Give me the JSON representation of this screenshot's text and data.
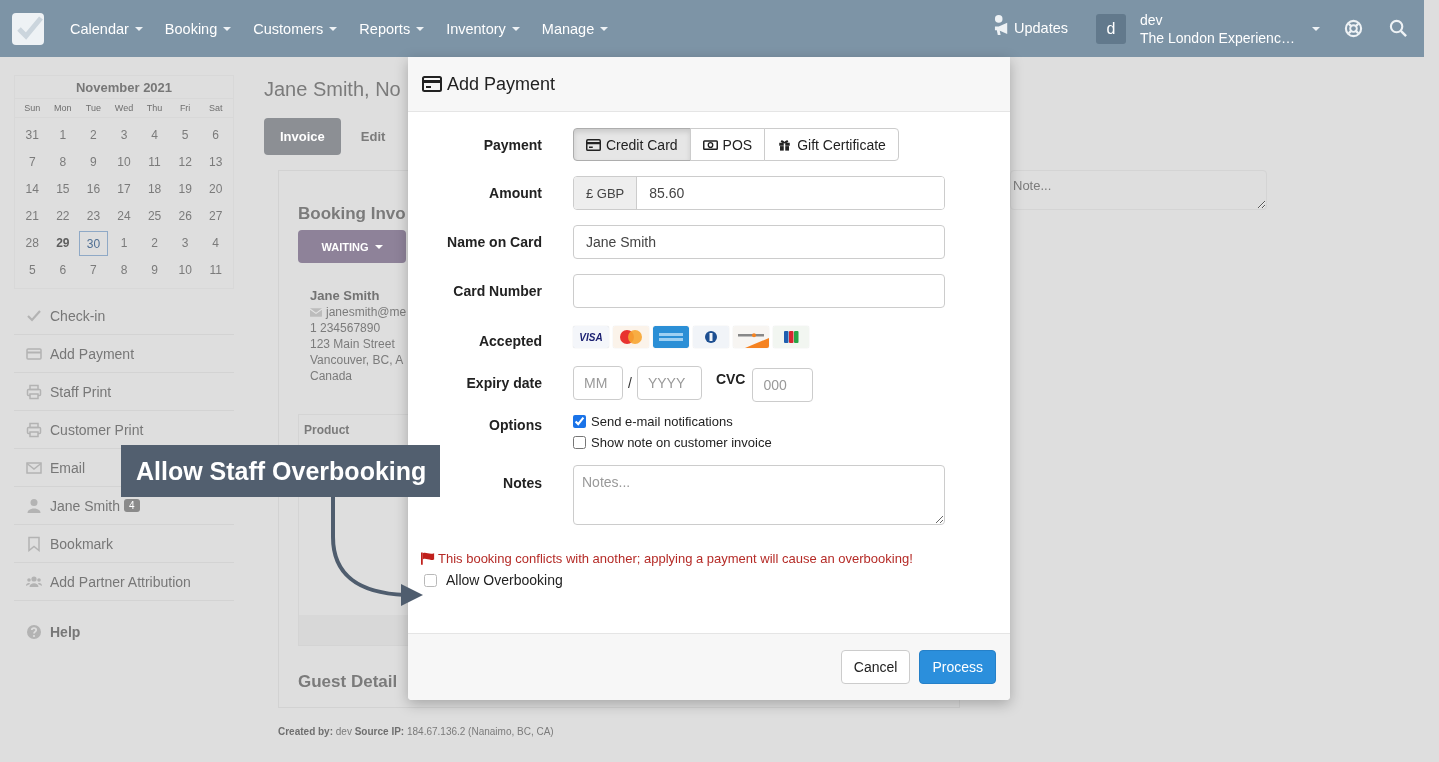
{
  "navbar": {
    "menus": [
      "Calendar",
      "Booking",
      "Customers",
      "Reports",
      "Inventory",
      "Manage"
    ],
    "updates": "Updates",
    "avatar": "d",
    "user": "dev",
    "account": "The London Experienc…"
  },
  "calendar": {
    "title": "November 2021",
    "weekdays": [
      "Sun",
      "Mon",
      "Tue",
      "Wed",
      "Thu",
      "Fri",
      "Sat"
    ],
    "weeks": [
      [
        {
          "day": "31",
          "today": false,
          "selected": false
        },
        {
          "day": "1",
          "today": false,
          "selected": false
        },
        {
          "day": "2",
          "today": false,
          "selected": false
        },
        {
          "day": "3",
          "today": false,
          "selected": false
        },
        {
          "day": "4",
          "today": false,
          "selected": false
        },
        {
          "day": "5",
          "today": false,
          "selected": false
        },
        {
          "day": "6",
          "today": false,
          "selected": false
        }
      ],
      [
        {
          "day": "7",
          "today": false,
          "selected": false
        },
        {
          "day": "8",
          "today": false,
          "selected": false
        },
        {
          "day": "9",
          "today": false,
          "selected": false
        },
        {
          "day": "10",
          "today": false,
          "selected": false
        },
        {
          "day": "11",
          "today": false,
          "selected": false
        },
        {
          "day": "12",
          "today": false,
          "selected": false
        },
        {
          "day": "13",
          "today": false,
          "selected": false
        }
      ],
      [
        {
          "day": "14",
          "today": false,
          "selected": false
        },
        {
          "day": "15",
          "today": false,
          "selected": false
        },
        {
          "day": "16",
          "today": false,
          "selected": false
        },
        {
          "day": "17",
          "today": false,
          "selected": false
        },
        {
          "day": "18",
          "today": false,
          "selected": false
        },
        {
          "day": "19",
          "today": false,
          "selected": false
        },
        {
          "day": "20",
          "today": false,
          "selected": false
        }
      ],
      [
        {
          "day": "21",
          "today": false,
          "selected": false
        },
        {
          "day": "22",
          "today": false,
          "selected": false
        },
        {
          "day": "23",
          "today": false,
          "selected": false
        },
        {
          "day": "24",
          "today": false,
          "selected": false
        },
        {
          "day": "25",
          "today": false,
          "selected": false
        },
        {
          "day": "26",
          "today": false,
          "selected": false
        },
        {
          "day": "27",
          "today": false,
          "selected": false
        }
      ],
      [
        {
          "day": "28",
          "today": false,
          "selected": false
        },
        {
          "day": "29",
          "today": true,
          "selected": false
        },
        {
          "day": "30",
          "today": false,
          "selected": true
        },
        {
          "day": "1",
          "today": false,
          "selected": false
        },
        {
          "day": "2",
          "today": false,
          "selected": false
        },
        {
          "day": "3",
          "today": false,
          "selected": false
        },
        {
          "day": "4",
          "today": false,
          "selected": false
        }
      ],
      [
        {
          "day": "5",
          "today": false,
          "selected": false
        },
        {
          "day": "6",
          "today": false,
          "selected": false
        },
        {
          "day": "7",
          "today": false,
          "selected": false
        },
        {
          "day": "8",
          "today": false,
          "selected": false
        },
        {
          "day": "9",
          "today": false,
          "selected": false
        },
        {
          "day": "10",
          "today": false,
          "selected": false
        },
        {
          "day": "11",
          "today": false,
          "selected": false
        }
      ]
    ]
  },
  "sidebar_menu": [
    {
      "kind": "check",
      "label": "Check-in"
    },
    {
      "kind": "card",
      "label": "Add Payment"
    },
    {
      "kind": "print",
      "label": "Staff Print"
    },
    {
      "kind": "print",
      "label": "Customer Print"
    },
    {
      "kind": "mail",
      "label": "Email"
    },
    {
      "kind": "user",
      "label": "Jane Smith",
      "badge": "4"
    },
    {
      "kind": "bookmark",
      "label": "Bookmark"
    },
    {
      "kind": "users",
      "label": "Add Partner Attribution"
    }
  ],
  "help": "Help",
  "page_title": "Jane Smith, No",
  "tabs": [
    {
      "label": "Invoice",
      "selected": true
    },
    {
      "label": "Edit",
      "selected": false
    }
  ],
  "invoice": {
    "title": "Booking Invo",
    "status": "WAITING",
    "customer_name": "Jane Smith",
    "email": "janesmith@me",
    "lines": [
      "1 234567890",
      "123 Main Street",
      "Vancouver, BC, A",
      "Canada"
    ],
    "product_header": "Product",
    "guest_title": "Guest Detail"
  },
  "note_placeholder": "Note...",
  "footer": "**Created by:** dev **Source IP:** 184.67.136.2 (Nanaimo, BC, CA)",
  "modal": {
    "title": "Add Payment",
    "payment_label": "Payment",
    "payment_methods": [
      {
        "kind": "card",
        "label": "Credit Card",
        "selected": true
      },
      {
        "kind": "cash",
        "label": "POS",
        "selected": false
      },
      {
        "kind": "gift",
        "label": "Gift Certificate",
        "selected": false
      }
    ],
    "amount_label": "Amount",
    "currency": "£ GBP",
    "amount": "85.60",
    "name_label": "Name on Card",
    "name": "Jane Smith",
    "card_number_label": "Card Number",
    "accepted_label": "Accepted",
    "accepted_cards": [
      {
        "kind": "visa",
        "label": "VISA"
      },
      {
        "kind": "mastercard"
      },
      {
        "kind": "amex"
      },
      {
        "kind": "diners"
      },
      {
        "kind": "discover"
      },
      {
        "kind": "jcb"
      }
    ],
    "expiry_label": "Expiry date",
    "month_placeholder": "MM",
    "separator": "/",
    "year_placeholder": "YYYY",
    "cvc_label": "CVC",
    "cvc_placeholder": "000",
    "options_label": "Options",
    "options": [
      {
        "label": "Send e-mail notifications",
        "checked": true
      },
      {
        "label": "Show note on customer invoice",
        "checked": false
      }
    ],
    "notes_label": "Notes",
    "notes_placeholder": "Notes...",
    "warning": "This booking conflicts with another; applying a payment will cause an overbooking!",
    "allow_overbooking": {
      "label": "Allow Overbooking",
      "checked": false
    },
    "buttons": [
      {
        "kind": "default",
        "label": "Cancel"
      },
      {
        "kind": "primary",
        "label": "Process"
      }
    ]
  },
  "callout": "Allow Staff Overbooking"
}
